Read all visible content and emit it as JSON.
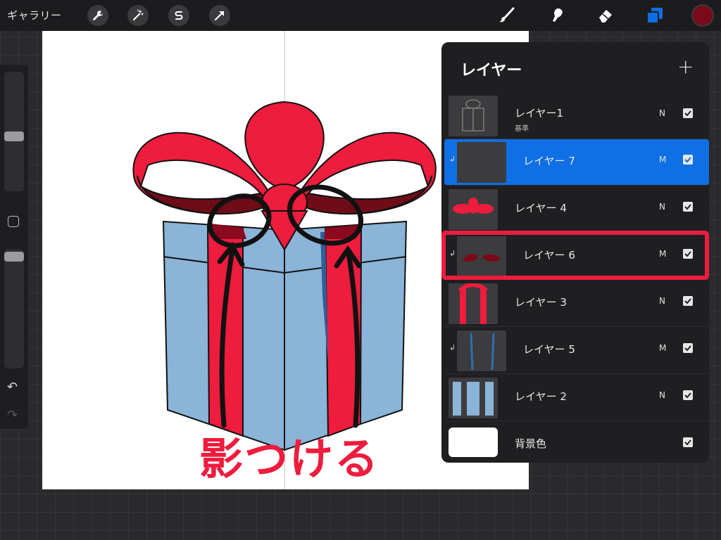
{
  "toolbar": {
    "gallery_label": "ギャラリー",
    "left_tools": [
      "wrench-icon",
      "magic-wand-icon",
      "selection-s-icon",
      "transform-arrow-icon"
    ],
    "right_tools": [
      "brush-icon",
      "smudge-icon",
      "eraser-icon",
      "layers-icon"
    ],
    "accent_color": "#0f6fe4",
    "current_color": "#7a0a18"
  },
  "sidebar": {
    "brush_size_level": 0.5,
    "opacity_level": 0.05,
    "undo_icon": "undo-icon",
    "redo_icon": "redo-icon"
  },
  "canvas": {
    "caption": "影つける",
    "caption_color": "#ee1c3d"
  },
  "layers_panel": {
    "title": "レイヤー",
    "add_label": "+",
    "layers": [
      {
        "name": "レイヤー1",
        "sub": "基準",
        "blend": "N",
        "visible": true,
        "clipped": false,
        "selected": false
      },
      {
        "name": "レイヤー 7",
        "sub": "",
        "blend": "M",
        "visible": true,
        "clipped": true,
        "selected": true
      },
      {
        "name": "レイヤー 4",
        "sub": "",
        "blend": "N",
        "visible": true,
        "clipped": false,
        "selected": false
      },
      {
        "name": "レイヤー 6",
        "sub": "",
        "blend": "M",
        "visible": true,
        "clipped": true,
        "selected": false
      },
      {
        "name": "レイヤー 3",
        "sub": "",
        "blend": "N",
        "visible": true,
        "clipped": false,
        "selected": false
      },
      {
        "name": "レイヤー 5",
        "sub": "",
        "blend": "M",
        "visible": true,
        "clipped": true,
        "selected": false
      },
      {
        "name": "レイヤー 2",
        "sub": "",
        "blend": "N",
        "visible": true,
        "clipped": false,
        "selected": false
      },
      {
        "name": "背景色",
        "sub": "",
        "blend": "",
        "visible": true,
        "clipped": false,
        "selected": false
      }
    ],
    "highlight_color": "#ee1c3d"
  }
}
